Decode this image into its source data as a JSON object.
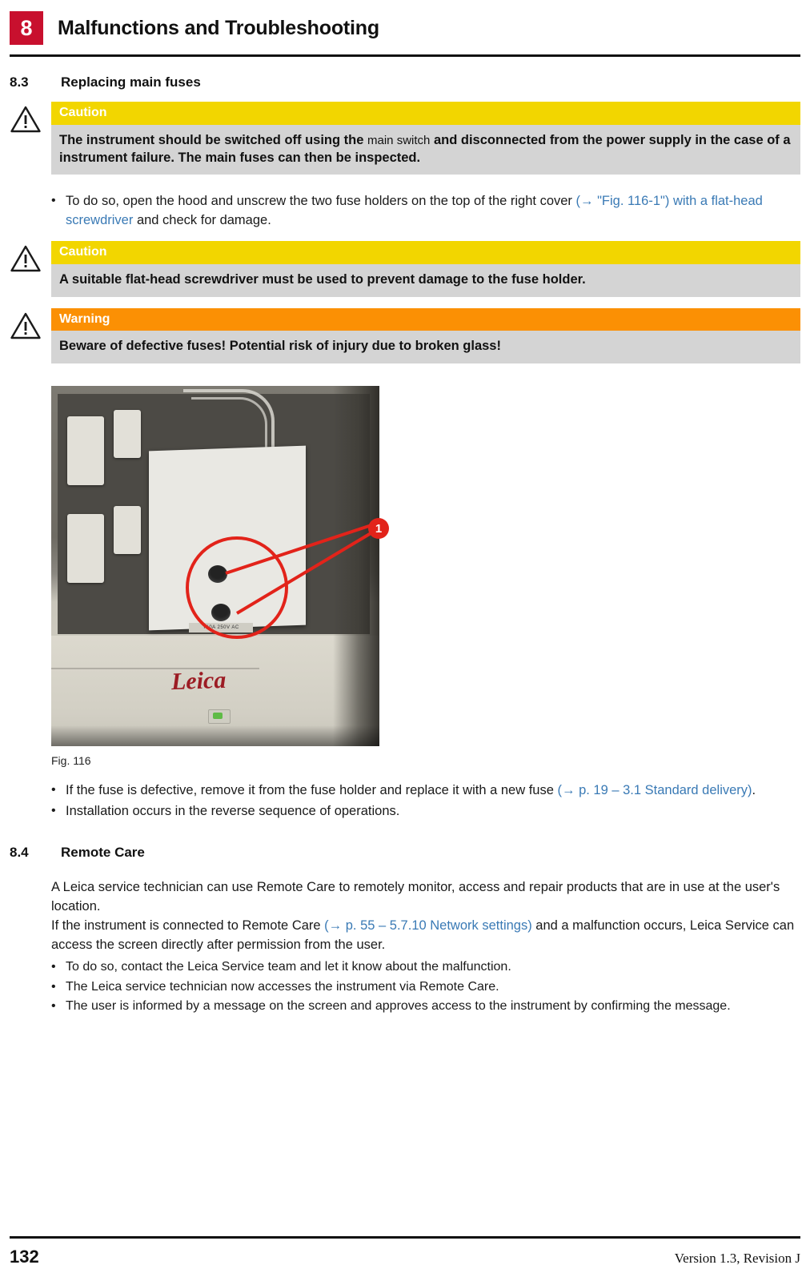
{
  "header": {
    "chapter_number": "8",
    "title": "Malfunctions and Troubleshooting"
  },
  "sections": [
    {
      "number": "8.3",
      "title": "Replacing main fuses"
    },
    {
      "number": "8.4",
      "title": "Remote Care"
    }
  ],
  "notices": [
    {
      "type": "caution",
      "label": "Caution",
      "text_1": "The instrument should be switched off using the ",
      "text_thin": "main switch",
      "text_2": " and disconnected from the power supply in the case of a instrument failure. The main fuses can then be inspected."
    },
    {
      "type": "caution",
      "label": "Caution",
      "text_1": "A suitable flat-head screwdriver must be used to prevent damage to the fuse holder."
    },
    {
      "type": "warning",
      "label": "Warning",
      "text_1": "Beware of defective fuses! Potential risk of injury due to broken glass!"
    }
  ],
  "bullets_top": [
    {
      "part_1": "To do so, open the hood and unscrew the two fuse holders on the top of the right cover ",
      "link": "(→ \"Fig. 116-1\") with a flat-head screwdriver",
      "part_2": " and check for damage."
    }
  ],
  "figure": {
    "caption": "Fig. 116",
    "callout_number": "1",
    "fuse_label": "T10A 250V AC"
  },
  "bullets_after_figure": [
    {
      "part_1": "If the fuse is defective, remove it from the fuse holder and replace it with a new fuse ",
      "link": "(→ p. 19 – 3.1 Standard delivery)",
      "part_2": "."
    },
    {
      "part_1": "Installation occurs in the reverse sequence of operations.",
      "link": "",
      "part_2": ""
    }
  ],
  "remote_care": {
    "paragraph_1": "A Leica service technician can use Remote Care to remotely monitor, access and repair products that are in use at the user's location.",
    "paragraph_2_part1": "If the instrument is connected to Remote Care ",
    "paragraph_2_link": "(→ p. 55 – 5.7.10 Network settings)",
    "paragraph_2_part2": " and a malfunction occurs, Leica Service can access the screen directly after permission from the user.",
    "bullets": [
      "To do so, contact the Leica Service team and let it know about the malfunction.",
      "The Leica service technician now accesses the instrument via Remote Care.",
      "The user is informed by a message on the screen and approves access to the instrument by confirming the message."
    ]
  },
  "footer": {
    "page_number": "132",
    "version": "Version 1.3, Revision J"
  },
  "colors": {
    "chapter_badge": "#c8102e",
    "caution": "#f2d600",
    "warning": "#fb9004",
    "notice_body": "#d4d4d4",
    "link": "#3a7ab5",
    "callout": "#e2231a"
  }
}
